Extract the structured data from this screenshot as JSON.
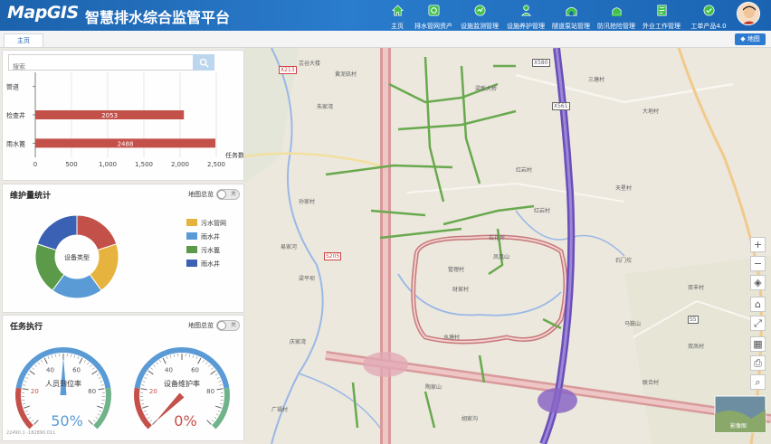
{
  "header": {
    "logo_text": "MapGIS",
    "title": "智慧排水综合监管平台",
    "nav": [
      {
        "label": "主页",
        "icon": "home-icon"
      },
      {
        "label": "排水管网资产",
        "icon": "pipe-asset-icon"
      },
      {
        "label": "设施监测管理",
        "icon": "monitor-icon"
      },
      {
        "label": "设施养护管理",
        "icon": "maintenance-icon"
      },
      {
        "label": "隧道泵站管理",
        "icon": "tunnel-icon"
      },
      {
        "label": "防汛抢险管理",
        "icon": "flood-icon"
      },
      {
        "label": "外业工作管理",
        "icon": "fieldwork-icon"
      },
      {
        "label": "工单产品4.0",
        "icon": "workorder-icon"
      }
    ],
    "avatar_icon": "user-avatar-icon"
  },
  "tabs": {
    "home": "主页",
    "map_button": "地图"
  },
  "search": {
    "placeholder": "搜索",
    "button_icon": "search-icon"
  },
  "bar_panel": {
    "unit_label": "任务数",
    "chart_data": {
      "type": "bar",
      "orientation": "horizontal",
      "categories": [
        "管道",
        "检查井",
        "雨水篦"
      ],
      "values": [
        0,
        2053,
        2488
      ],
      "data_labels": [
        "",
        "2053",
        "2488"
      ],
      "xlim": [
        0,
        2500
      ],
      "xticks": [
        "0",
        "500",
        "1,000",
        "1,500",
        "2,000",
        "2,500"
      ],
      "xlabel": "任务数",
      "bar_color": "#c4504a",
      "grid": true
    }
  },
  "maintenance_panel": {
    "title": "维护量统计",
    "map_link_label": "地图总览",
    "toggle_label": "关",
    "chart_data": {
      "type": "pie",
      "donut": true,
      "center_label": "设备类型",
      "legend_position": "right",
      "slices": [
        {
          "name": "污水管网",
          "value": 25,
          "color": "#e6b43e"
        },
        {
          "name": "雨水井",
          "value": 25,
          "color": "#5b9bd5"
        },
        {
          "name": "污水篦",
          "value": 25,
          "color": "#5a9a48"
        },
        {
          "name": "雨水井",
          "value": 25,
          "color": "#3a61b3"
        }
      ],
      "slice_draw_colors": [
        "#c4504a",
        "#e6b43e",
        "#5b9bd5",
        "#5a9a48",
        "#3a61b3"
      ]
    }
  },
  "task_panel": {
    "title": "任务执行",
    "map_link_label": "地图总览",
    "toggle_label": "关",
    "gauges": [
      {
        "label": "人员到位率",
        "value_text": "50%",
        "value": 50,
        "value_color": "#5b9bd5",
        "ticks": [
          "20",
          "40",
          "60",
          "80"
        ]
      },
      {
        "label": "设备维护率",
        "value_text": "0%",
        "value": 0,
        "value_color": "#c4504a",
        "ticks": [
          "20",
          "40",
          "60",
          "80"
        ]
      }
    ],
    "coords": "22490.1 -182890.011"
  },
  "map": {
    "labels": [
      "芸谷大楼",
      "黄泥矶村",
      "梁新大桥",
      "朱家湾",
      "三塘村",
      "大地村",
      "红岩村",
      "天星村",
      "孙家村",
      "石花坪",
      "凤凰山",
      "管理村",
      "财家村",
      "易家河",
      "红岩村",
      "梁平坝",
      "石门坎",
      "双丰村",
      "庆家湾",
      "马鞍山",
      "水塘村",
      "双凤村",
      "陶家山",
      "胡家沟",
      "联合村",
      "广福村"
    ],
    "road_codes": [
      "X213",
      "S205",
      "X561",
      "X580",
      "S5"
    ],
    "minimap_label": "影像图",
    "controls": [
      {
        "name": "zoom-in-button",
        "icon": "+"
      },
      {
        "name": "zoom-out-button",
        "icon": "−"
      },
      {
        "name": "layers-button",
        "icon": "◈"
      },
      {
        "name": "home-extent-button",
        "icon": "⌂"
      },
      {
        "name": "fullscreen-button",
        "icon": "⤢"
      },
      {
        "name": "buildings-button",
        "icon": "▦"
      },
      {
        "name": "print-button",
        "icon": "⎙"
      },
      {
        "name": "map-search-button",
        "icon": "⌕"
      }
    ]
  }
}
